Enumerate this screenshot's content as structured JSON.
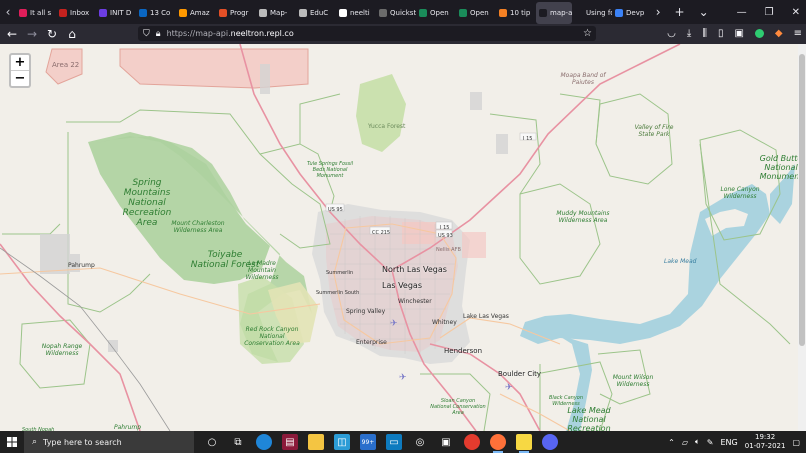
{
  "browser": {
    "tabs": [
      {
        "label": "It all s",
        "color": "#e01e5a"
      },
      {
        "label": "Inbox",
        "color": "#c5221f"
      },
      {
        "label": "INIT D",
        "color": "#6c3de3"
      },
      {
        "label": "13 Co",
        "color": "#0a66c2"
      },
      {
        "label": "Amaz",
        "color": "#ff9900"
      },
      {
        "label": "Progr",
        "color": "#e34f26"
      },
      {
        "label": "Map-",
        "color": "#bbbbbb"
      },
      {
        "label": "EduC",
        "color": "#bbbbbb"
      },
      {
        "label": "neelti",
        "color": "#ffffff"
      },
      {
        "label": "Quickstar",
        "color": "#6b6b6b"
      },
      {
        "label": "Open",
        "color": "#1a8c5a"
      },
      {
        "label": "Open",
        "color": "#1a8c5a"
      },
      {
        "label": "10 tip",
        "color": "#f48024"
      },
      {
        "label": "map-a",
        "color": "#1c1b22",
        "active": true
      },
      {
        "label": "Using fol",
        "color": "#1c1b22"
      },
      {
        "label": "Devp",
        "color": "#3b82f6"
      }
    ],
    "url_lead": "https://map-api.",
    "url_domain": "neeltron.repl.co",
    "url_tail": ""
  },
  "map": {
    "zoom_in": "+",
    "zoom_out": "−",
    "labels": {
      "area22": "Area 22",
      "yucca": "Yucca Forest",
      "moapa": "Moapa Band of Paiutes",
      "valleyfire": "Valley of Fire State Park",
      "goldbutte": "Gold Butte National Monument",
      "spring": "Spring Mountains National Recreation Area",
      "tule": "Tule Springs Fossil Beds National Monument",
      "mtcharleston": "Mount Charleston Wilderness Area",
      "toiyabe": "Toiyabe National Forest",
      "lamadre": "La Madre Mountain Wilderness",
      "pahrump": "Pahrump",
      "nlv": "North Las Vegas",
      "lv": "Las Vegas",
      "summerlin": "Summerlin",
      "summerlinsouth": "Summerlin South",
      "springvalley": "Spring Valley",
      "winchester": "Winchester",
      "whitney": "Whitney",
      "enterprise": "Enterprise",
      "henderson": "Henderson",
      "lakelv": "Lake Las Vegas",
      "bouldercity": "Boulder City",
      "nellis": "Nellis AFB",
      "muddy": "Muddy Mountains Wilderness Area",
      "lonecanyon": "Lone Canyon Wilderness",
      "lakemead": "Lake Mead",
      "lmnra": "Lake Mead National Recreation",
      "redrock": "Red Rock Canyon National Conservation Area",
      "nopah": "Nopah Range Wilderness",
      "sloan": "Sloan Canyon National Conservation Area",
      "blackcanyon": "Black Canyon Wilderness",
      "mtwilson": "Mount Wilson Wilderness",
      "southnopah": "South Nopah",
      "pahrump2": "Pahrump",
      "us95": "US 95",
      "cc215": "CC 215",
      "i15a": "I 15",
      "i15b": "I 15",
      "us93": "US 93"
    }
  },
  "taskbar": {
    "search_placeholder": "Type here to search",
    "badge": "99+",
    "lang": "ENG",
    "time": "19:32",
    "date": "01-07-2021"
  }
}
